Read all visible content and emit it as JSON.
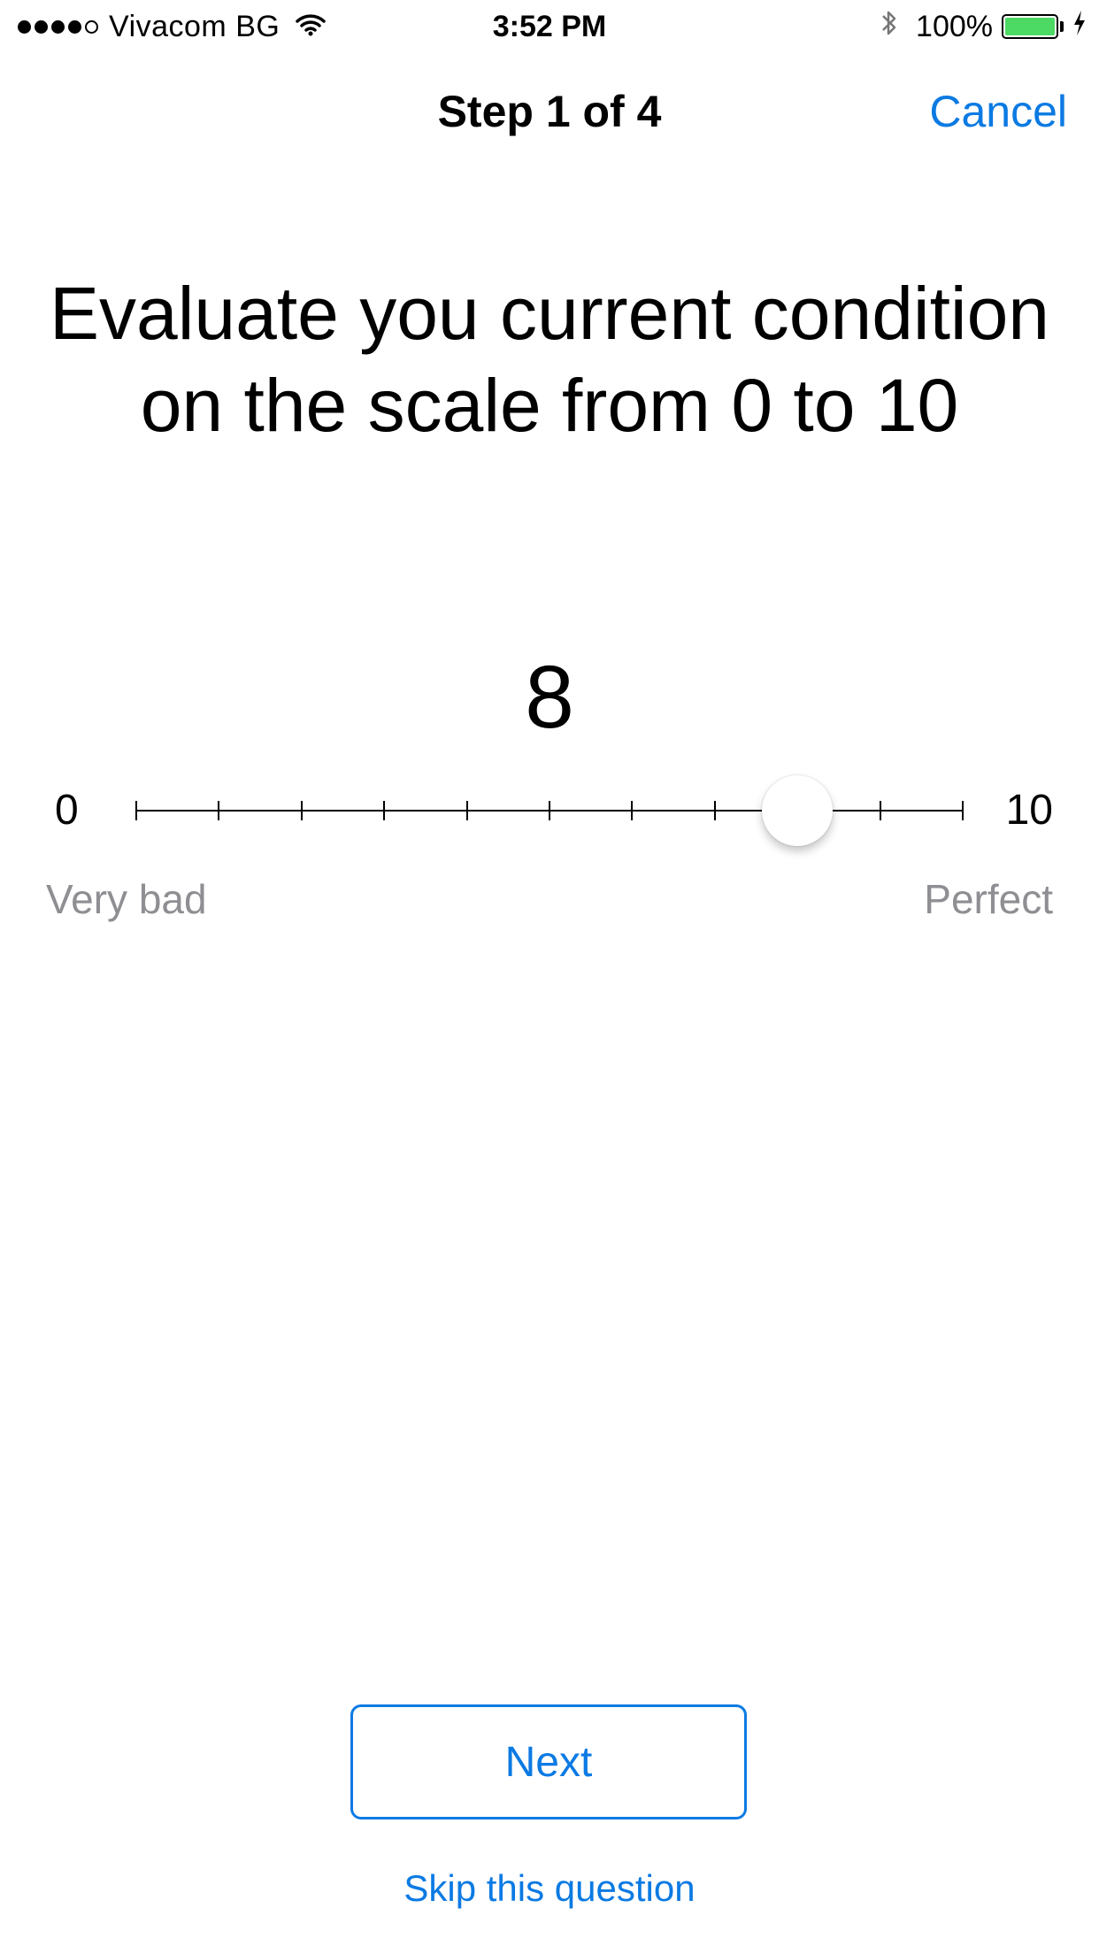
{
  "status_bar": {
    "carrier": "Vivacom BG",
    "signal_bars_filled": 4,
    "signal_bars_total": 5,
    "time": "3:52 PM",
    "battery_percent": "100%",
    "icons": [
      "wifi-icon",
      "bluetooth-icon",
      "battery-icon",
      "charging-bolt-icon"
    ],
    "battery_color": "#4cd964"
  },
  "nav": {
    "title": "Step 1 of 4",
    "cancel_label": "Cancel"
  },
  "question": {
    "text": "Evaluate you current condition on the scale from 0 to 10"
  },
  "scale": {
    "current_value": "8",
    "min": 0,
    "max": 10,
    "value": 8,
    "min_label": "0",
    "max_label": "10",
    "min_description": "Very bad",
    "max_description": "Perfect"
  },
  "actions": {
    "next_label": "Next",
    "skip_label": "Skip this question"
  },
  "colors": {
    "accent": "#0b7ae3",
    "secondary_text": "#8e8e93"
  }
}
